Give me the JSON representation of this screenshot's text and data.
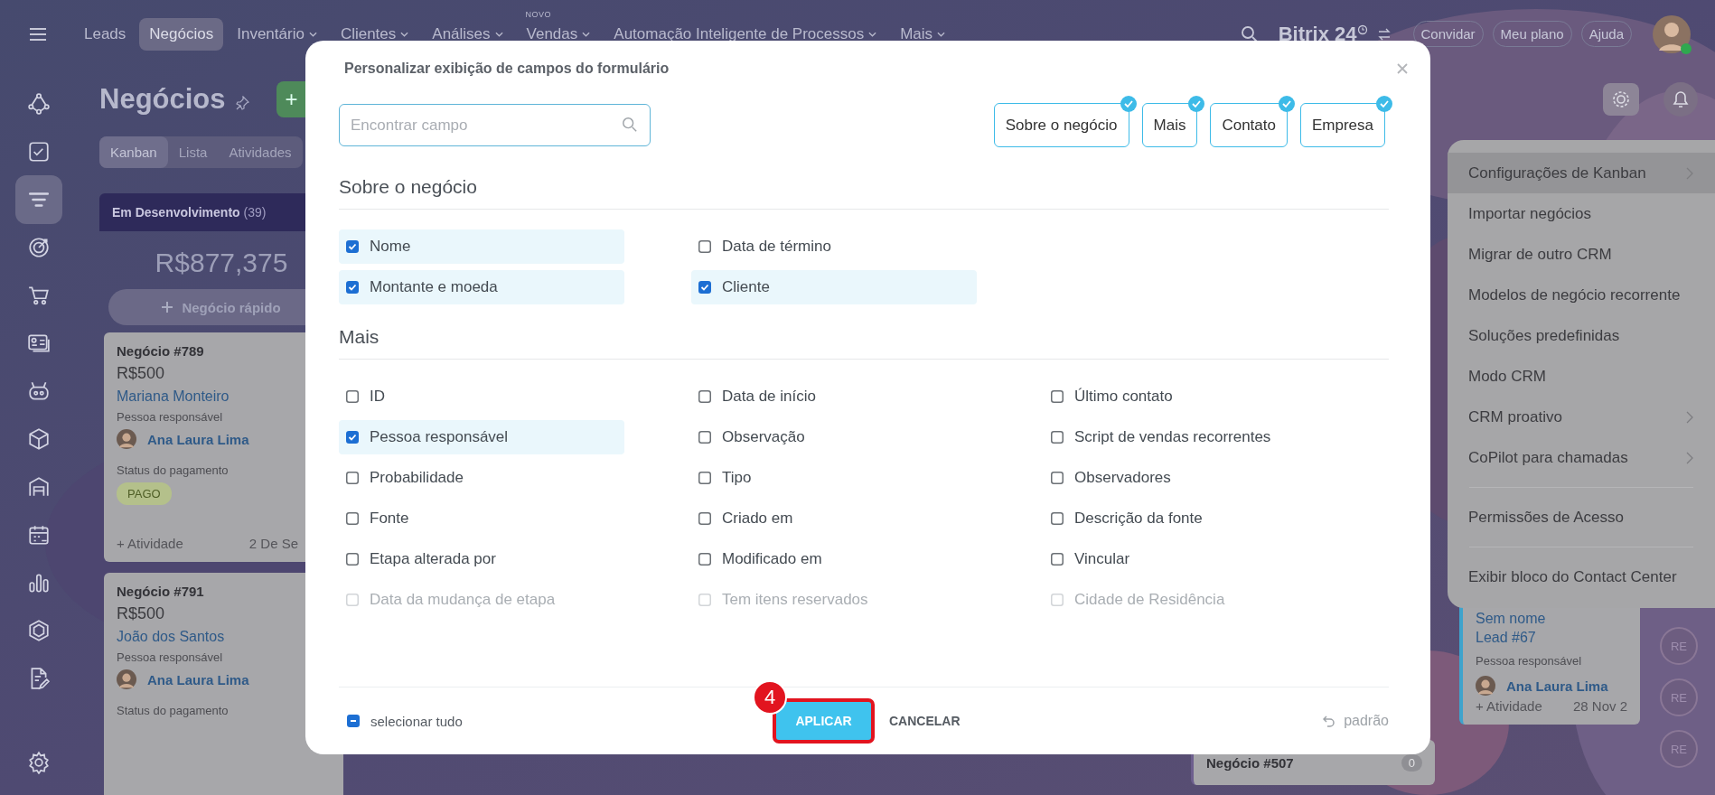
{
  "topbar": {
    "nav": [
      {
        "label": "Leads",
        "selected": false,
        "dropdown": false
      },
      {
        "label": "Negócios",
        "selected": true,
        "dropdown": false
      },
      {
        "label": "Inventário",
        "selected": false,
        "dropdown": true
      },
      {
        "label": "Clientes",
        "selected": false,
        "dropdown": true
      },
      {
        "label": "Análises",
        "selected": false,
        "dropdown": true
      },
      {
        "label": "Vendas",
        "selected": false,
        "dropdown": true,
        "badge": "NOVO"
      },
      {
        "label": "Automação Inteligente de Processos",
        "selected": false,
        "dropdown": true
      },
      {
        "label": "Mais",
        "selected": false,
        "dropdown": true
      }
    ],
    "logo": "Bitrix",
    "logo_suffix": "24",
    "buttons": [
      "Convidar",
      "Meu plano",
      "Ajuda"
    ]
  },
  "sidebar": {
    "items": [
      {
        "kind": "flow",
        "selected": false
      },
      {
        "kind": "tasks",
        "selected": false
      },
      {
        "kind": "funnel",
        "selected": true
      },
      {
        "kind": "target",
        "selected": false
      },
      {
        "kind": "cart",
        "selected": false
      },
      {
        "kind": "card",
        "selected": false
      },
      {
        "kind": "robot",
        "selected": false
      },
      {
        "kind": "box",
        "selected": false
      },
      {
        "kind": "store",
        "selected": false
      },
      {
        "kind": "calendar",
        "selected": false
      },
      {
        "kind": "chart",
        "selected": false
      },
      {
        "kind": "hexagon",
        "selected": false
      },
      {
        "kind": "document",
        "selected": false
      },
      {
        "kind": "settings",
        "selected": false
      }
    ]
  },
  "page": {
    "title": "Negócios",
    "add_button": "+",
    "views": [
      {
        "label": "Kanban",
        "selected": true
      },
      {
        "label": "Lista",
        "selected": false
      },
      {
        "label": "Atividades",
        "selected": false
      }
    ]
  },
  "kanban": {
    "column": {
      "title": "Em Desenvolvimento",
      "count": "(39)",
      "total": "R$877,375",
      "quick_add": "Negócio rápido"
    },
    "cards": [
      {
        "title": "Negócio #789",
        "amount": "R$500",
        "client": "Mariana Monteiro",
        "responsible_label": "Pessoa responsável",
        "responsible": "Ana Laura Lima",
        "status_label": "Status do pagamento",
        "status": "PAGO",
        "activity": "+ Atividade",
        "date": "2 De Se"
      },
      {
        "title": "Negócio #791",
        "amount": "R$500",
        "client": "João dos Santos",
        "responsible_label": "Pessoa responsável",
        "responsible": "Ana Laura Lima",
        "status_label": "Status do pagamento"
      }
    ],
    "bottom_card": {
      "title": "Negócio #507",
      "count": "0"
    },
    "right_card": {
      "title": "Sem nome",
      "subtitle": "Lead #67",
      "responsible_label": "Pessoa responsável",
      "responsible": "Ana Laura Lima",
      "activity": "+ Atividade",
      "date": "28 Nov 2"
    },
    "avatars": [
      "RE",
      "RE",
      "RE"
    ]
  },
  "menu": {
    "groups": [
      [
        {
          "label": "Configurações de Kanban",
          "submenu": true,
          "selected": true
        },
        {
          "label": "Importar negócios",
          "submenu": false,
          "selected": false
        },
        {
          "label": "Migrar de outro CRM",
          "submenu": false,
          "selected": false
        },
        {
          "label": "Modelos de negócio recorrente",
          "submenu": false,
          "selected": false
        },
        {
          "label": "Soluções predefinidas",
          "submenu": false,
          "selected": false
        },
        {
          "label": "Modo CRM",
          "submenu": false,
          "selected": false
        },
        {
          "label": "CRM proativo",
          "submenu": true,
          "selected": false
        },
        {
          "label": "CoPilot para chamadas",
          "submenu": true,
          "selected": false
        }
      ],
      [
        {
          "label": "Permissões de Acesso",
          "submenu": false,
          "selected": false
        }
      ],
      [
        {
          "label": "Exibir bloco do Contact Center",
          "submenu": false,
          "selected": false
        }
      ]
    ]
  },
  "dialog": {
    "title": "Personalizar exibição de campos do formulário",
    "search": {
      "placeholder": "Encontrar campo"
    },
    "chips": [
      {
        "label": "Sobre o negócio",
        "selected": true
      },
      {
        "label": "Mais",
        "selected": true
      },
      {
        "label": "Contato",
        "selected": true
      },
      {
        "label": "Empresa",
        "selected": true
      }
    ],
    "sections": [
      {
        "title": "Sobre o negócio",
        "columns": [
          [
            {
              "label": "Nome",
              "checked": true,
              "disabled": false
            },
            {
              "label": "Montante e moeda",
              "checked": true,
              "disabled": false
            }
          ],
          [
            {
              "label": "Data de término",
              "checked": false,
              "disabled": false
            },
            {
              "label": "Cliente",
              "checked": true,
              "disabled": false
            }
          ]
        ]
      },
      {
        "title": "Mais",
        "columns": [
          [
            {
              "label": "ID",
              "checked": false,
              "disabled": false
            },
            {
              "label": "Pessoa responsável",
              "checked": true,
              "disabled": false
            },
            {
              "label": "Probabilidade",
              "checked": false,
              "disabled": false
            },
            {
              "label": "Fonte",
              "checked": false,
              "disabled": false
            },
            {
              "label": "Etapa alterada por",
              "checked": false,
              "disabled": false
            },
            {
              "label": "Data da mudança de etapa",
              "checked": false,
              "disabled": true
            }
          ],
          [
            {
              "label": "Data de início",
              "checked": false,
              "disabled": false
            },
            {
              "label": "Observação",
              "checked": false,
              "disabled": false
            },
            {
              "label": "Tipo",
              "checked": false,
              "disabled": false
            },
            {
              "label": "Criado em",
              "checked": false,
              "disabled": false
            },
            {
              "label": "Modificado em",
              "checked": false,
              "disabled": false
            },
            {
              "label": "Tem itens reservados",
              "checked": false,
              "disabled": true
            }
          ],
          [
            {
              "label": "Último contato",
              "checked": false,
              "disabled": false
            },
            {
              "label": "Script de vendas recorrentes",
              "checked": false,
              "disabled": false
            },
            {
              "label": "Observadores",
              "checked": false,
              "disabled": false
            },
            {
              "label": "Descrição da fonte",
              "checked": false,
              "disabled": false
            },
            {
              "label": "Vincular",
              "checked": false,
              "disabled": false
            },
            {
              "label": "Cidade de Residência",
              "checked": false,
              "disabled": true
            }
          ]
        ]
      }
    ],
    "select_all": {
      "label": "selecionar tudo",
      "indeterminate": true
    },
    "apply": {
      "label": "APLICAR",
      "highlighted": true,
      "step": "4"
    },
    "cancel": "CANCELAR",
    "reset": "padrão"
  }
}
